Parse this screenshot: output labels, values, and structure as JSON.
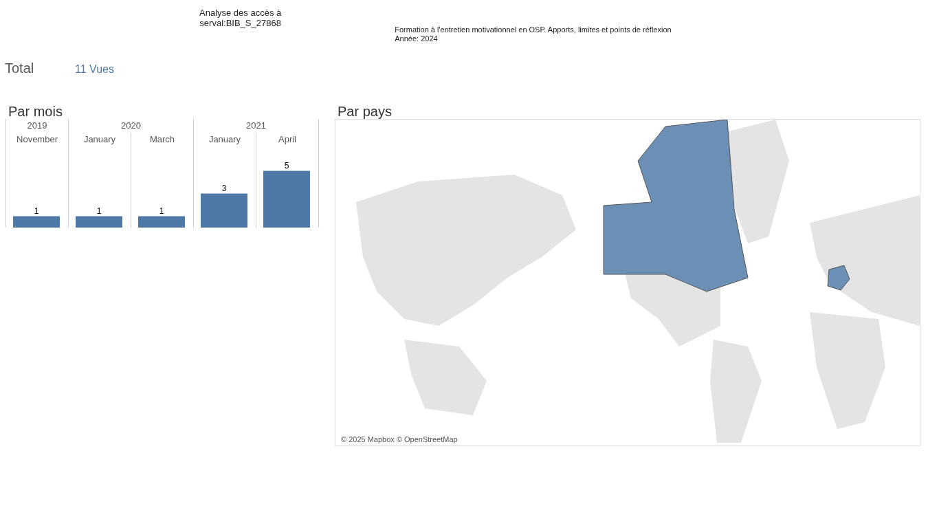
{
  "header": {
    "title_lines": [
      "Analyse des accès à",
      "serval:BIB_S_27868"
    ],
    "document": "Formation à l'entretien motivationnel en OSP. Apports, limites et points de réflexion",
    "year": "Année: 2024"
  },
  "total": {
    "label": "Total",
    "value": "11 Vues"
  },
  "by_month": {
    "title": "Par mois",
    "years": [
      "2019",
      "2020",
      "2021"
    ],
    "year_starts": [
      true,
      true,
      false,
      true,
      false
    ],
    "chart_data": {
      "type": "bar",
      "categories": [
        "November",
        "January",
        "March",
        "January",
        "April"
      ],
      "values": [
        1,
        1,
        1,
        3,
        5
      ],
      "data_labels": true
    }
  },
  "by_country": {
    "title": "Par pays",
    "attribution": "© 2025 Mapbox © OpenStreetMap"
  }
}
